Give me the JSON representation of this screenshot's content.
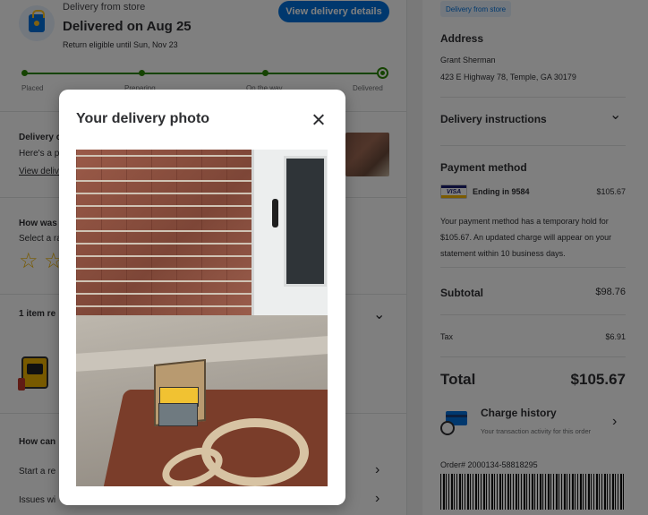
{
  "left": {
    "delivery_from": "Delivery from store",
    "delivered_title": "Delivered on Aug 25",
    "return_text": "Return eligible until Sun, Nov 23",
    "view_details_label": "View delivery details",
    "steps": [
      "Placed",
      "Preparing",
      "On the way",
      "Delivered"
    ],
    "photo_section": {
      "title": "Delivery c",
      "text": "Here's a pl",
      "link": "View delive"
    },
    "rating_section": {
      "title": "How was",
      "text": "Select a ra",
      "stars": [
        "☆",
        "☆"
      ]
    },
    "items_section": {
      "title": "1 item re"
    },
    "help_section": {
      "title": "How can",
      "item1": "Start a re",
      "item2": "Issues wi"
    }
  },
  "right": {
    "pill": "Delivery from store",
    "address_label": "Address",
    "address_name": "Grant Sherman",
    "address_line": "423 E Highway 78, Temple, GA 30179",
    "instructions_label": "Delivery instructions",
    "payment_label": "Payment method",
    "card_brand": "VISA",
    "card_ending": "Ending in 9584",
    "card_amount": "$105.67",
    "hold_text": "Your payment method has a temporary hold for $105.67. An updated charge will appear on your statement within 10 business days.",
    "subtotal_label": "Subtotal",
    "subtotal_value": "$98.76",
    "tax_label": "Tax",
    "tax_value": "$6.91",
    "total_label": "Total",
    "total_value": "$105.67",
    "charge_title": "Charge history",
    "charge_sub": "Your transaction activity for this order",
    "order_number": "Order# 2000134-58818295"
  },
  "modal": {
    "title": "Your delivery photo"
  },
  "colors": {
    "primary": "#0071dc",
    "progress": "#2a8703",
    "accent": "#ffc220"
  },
  "icons": [
    "store-bag-icon",
    "close-icon",
    "chevron-down-icon",
    "chevron-right-icon",
    "star-outline-icon",
    "visa-card-icon",
    "charge-history-icon"
  ]
}
